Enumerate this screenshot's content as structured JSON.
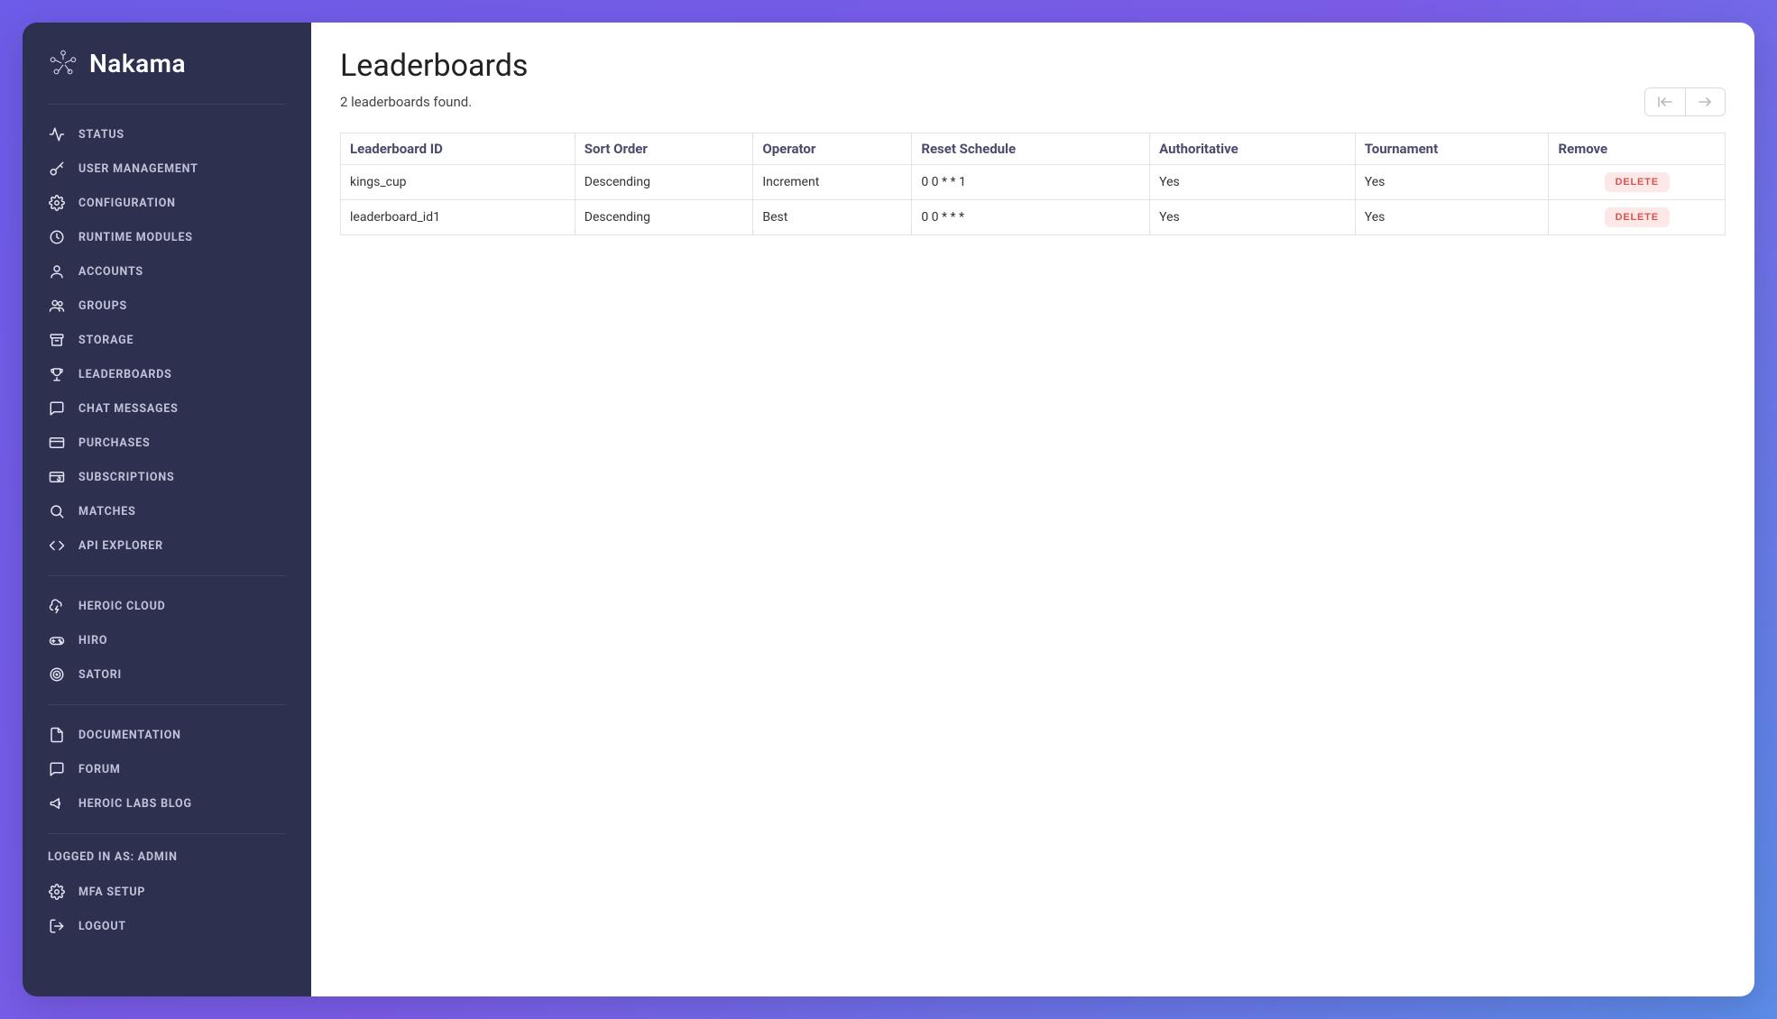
{
  "brand": {
    "name": "Nakama"
  },
  "sidebar": {
    "main": [
      {
        "label": "Status",
        "icon": "activity"
      },
      {
        "label": "User Management",
        "icon": "key"
      },
      {
        "label": "Configuration",
        "icon": "gear"
      },
      {
        "label": "Runtime Modules",
        "icon": "clock"
      },
      {
        "label": "Accounts",
        "icon": "user"
      },
      {
        "label": "Groups",
        "icon": "users"
      },
      {
        "label": "Storage",
        "icon": "archive"
      },
      {
        "label": "Leaderboards",
        "icon": "trophy"
      },
      {
        "label": "Chat Messages",
        "icon": "chat"
      },
      {
        "label": "Purchases",
        "icon": "card"
      },
      {
        "label": "Subscriptions",
        "icon": "card-repeat"
      },
      {
        "label": "Matches",
        "icon": "search"
      },
      {
        "label": "API Explorer",
        "icon": "code"
      }
    ],
    "external": [
      {
        "label": "Heroic Cloud",
        "icon": "cloud-bolt"
      },
      {
        "label": "Hiro",
        "icon": "gamepad"
      },
      {
        "label": "Satori",
        "icon": "target"
      }
    ],
    "docs": [
      {
        "label": "Documentation",
        "icon": "file"
      },
      {
        "label": "Forum",
        "icon": "chat"
      },
      {
        "label": "Heroic Labs Blog",
        "icon": "megaphone"
      }
    ],
    "logged_in_label": "Logged in as: admin",
    "account": [
      {
        "label": "MFA Setup",
        "icon": "gear"
      },
      {
        "label": "Logout",
        "icon": "logout"
      }
    ]
  },
  "page": {
    "title": "Leaderboards",
    "found_text": "2 leaderboards found."
  },
  "table": {
    "headers": {
      "id": "Leaderboard ID",
      "sort_order": "Sort Order",
      "operator": "Operator",
      "reset_schedule": "Reset Schedule",
      "authoritative": "Authoritative",
      "tournament": "Tournament",
      "remove": "Remove"
    },
    "delete_label": "Delete",
    "rows": [
      {
        "id": "kings_cup",
        "sort_order": "Descending",
        "operator": "Increment",
        "reset_schedule": "0 0 * * 1",
        "authoritative": "Yes",
        "tournament": "Yes"
      },
      {
        "id": "leaderboard_id1",
        "sort_order": "Descending",
        "operator": "Best",
        "reset_schedule": "0 0 * * *",
        "authoritative": "Yes",
        "tournament": "Yes"
      }
    ]
  }
}
